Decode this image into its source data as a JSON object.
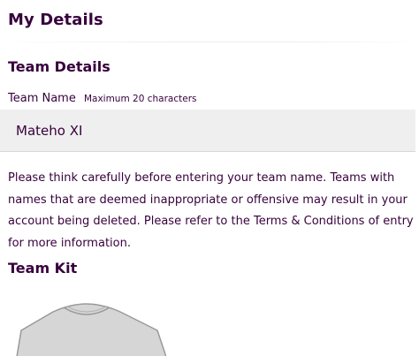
{
  "page_title": "My Details",
  "team_details": {
    "heading": "Team Details",
    "name_label": "Team Name",
    "name_hint": "Maximum 20 characters",
    "name_value": "Mateho XI",
    "notice": "Please think carefully before entering your team name. Teams with names that are deemed inappropriate or offensive may result in your account being deleted. Please refer to the Terms & Conditions of entry for more information."
  },
  "team_kit": {
    "heading": "Team Kit",
    "shirt_icon": "shirt-icon",
    "shirt_color": "#d6d6d6"
  },
  "colors": {
    "brand": "#37003c",
    "input_background": "#efefef"
  }
}
